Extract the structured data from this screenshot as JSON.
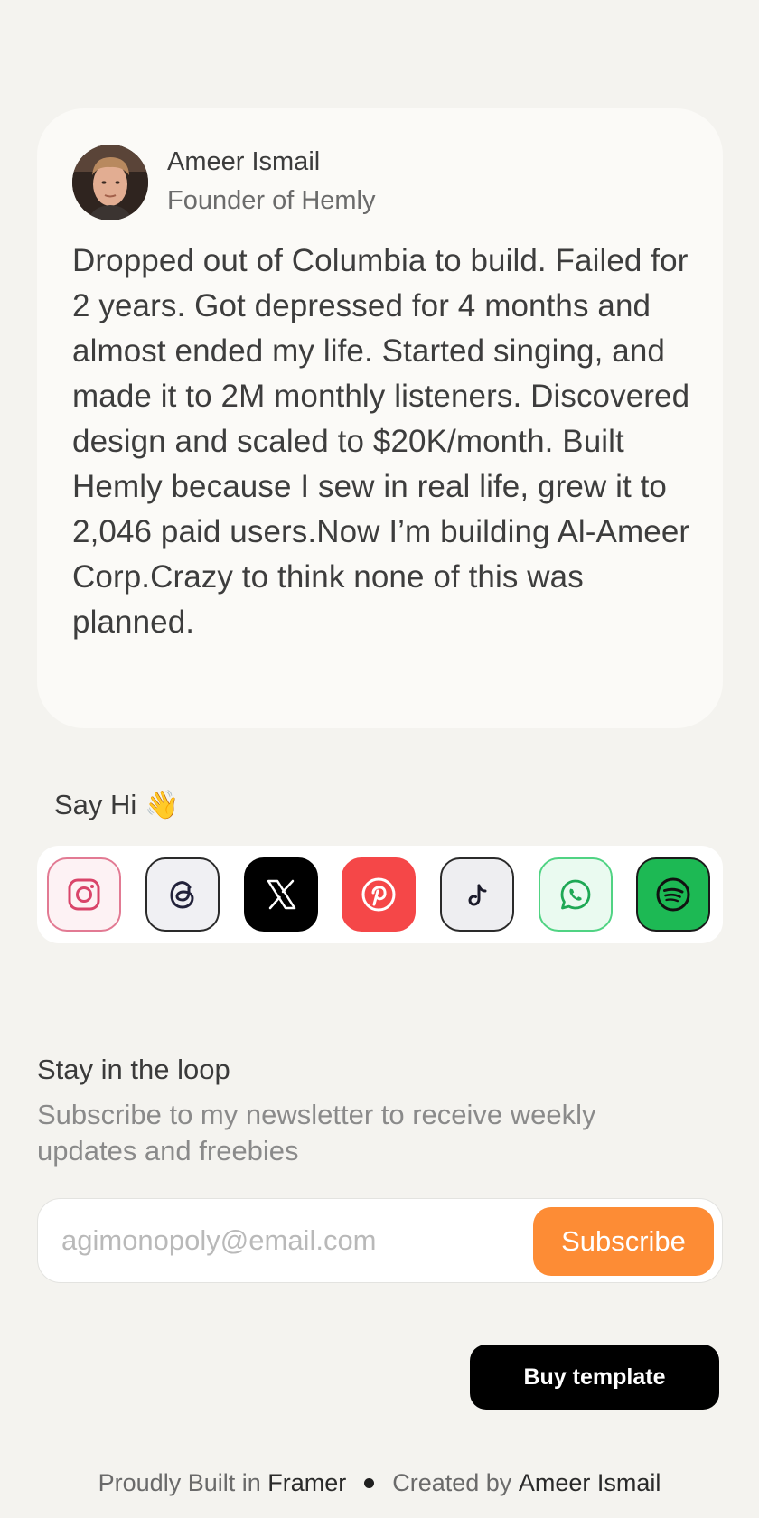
{
  "bio": {
    "name": "Ameer Ismail",
    "role": "Founder of Hemly",
    "text": "Dropped out of Columbia to build. Failed for 2 years. Got depressed for 4 months and almost ended my life. Started singing, and made it to 2M monthly listeners. Discovered design and scaled to $20K/month. Built Hemly because I sew in real life, grew it to 2,046 paid users.Now I’m building Al-Ameer Corp.Crazy to think none of this was planned."
  },
  "say_hi": {
    "label": "Say Hi",
    "emoji": "👋"
  },
  "socials": [
    {
      "icon": "instagram-icon",
      "color": "#e27a93"
    },
    {
      "icon": "threads-icon",
      "color": "#2a2a2a"
    },
    {
      "icon": "x-icon",
      "color": "#000000"
    },
    {
      "icon": "pinterest-icon",
      "color": "#f54748"
    },
    {
      "icon": "tiktok-icon",
      "color": "#2a2a2a"
    },
    {
      "icon": "whatsapp-icon",
      "color": "#50d383"
    },
    {
      "icon": "spotify-icon",
      "color": "#1db954"
    }
  ],
  "newsletter": {
    "title": "Stay in the loop",
    "description": "Subscribe to my newsletter to receive weekly updates and freebies",
    "placeholder": "agimonopoly@email.com",
    "button_label": "Subscribe",
    "button_color": "#fd8c35"
  },
  "buy_template": {
    "label": "Buy template"
  },
  "footer": {
    "built_prefix": "Proudly Built in ",
    "built_platform": "Framer",
    "created_prefix": "Created by ",
    "created_name": "Ameer Ismail"
  }
}
